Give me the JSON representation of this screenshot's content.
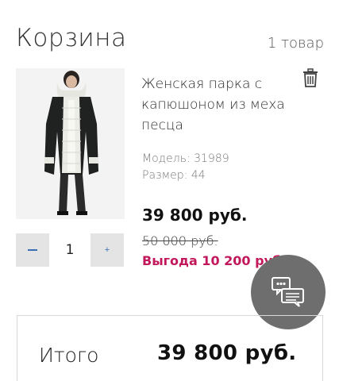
{
  "header": {
    "title": "Корзина",
    "item_count": "1 товар"
  },
  "cart_item": {
    "name": "Женская парка с капюшоном из меха песца",
    "model": "Модель: 31989",
    "size": "Размер: 44",
    "price": "39 800 руб.",
    "old_price": "50 000 руб.",
    "savings": "Выгода 10 200 руб.",
    "quantity": "1",
    "minus_icon": "minus-icon",
    "plus_icon": "plus-icon",
    "delete_icon": "trash-icon"
  },
  "chat": {
    "icon": "chat-bubbles-icon"
  },
  "summary": {
    "total_label": "Итого",
    "total_value": "39 800 руб."
  },
  "colors": {
    "accent": "#3b6fb5",
    "savings": "#c2185b",
    "chat_button": "#6e6e6e"
  }
}
